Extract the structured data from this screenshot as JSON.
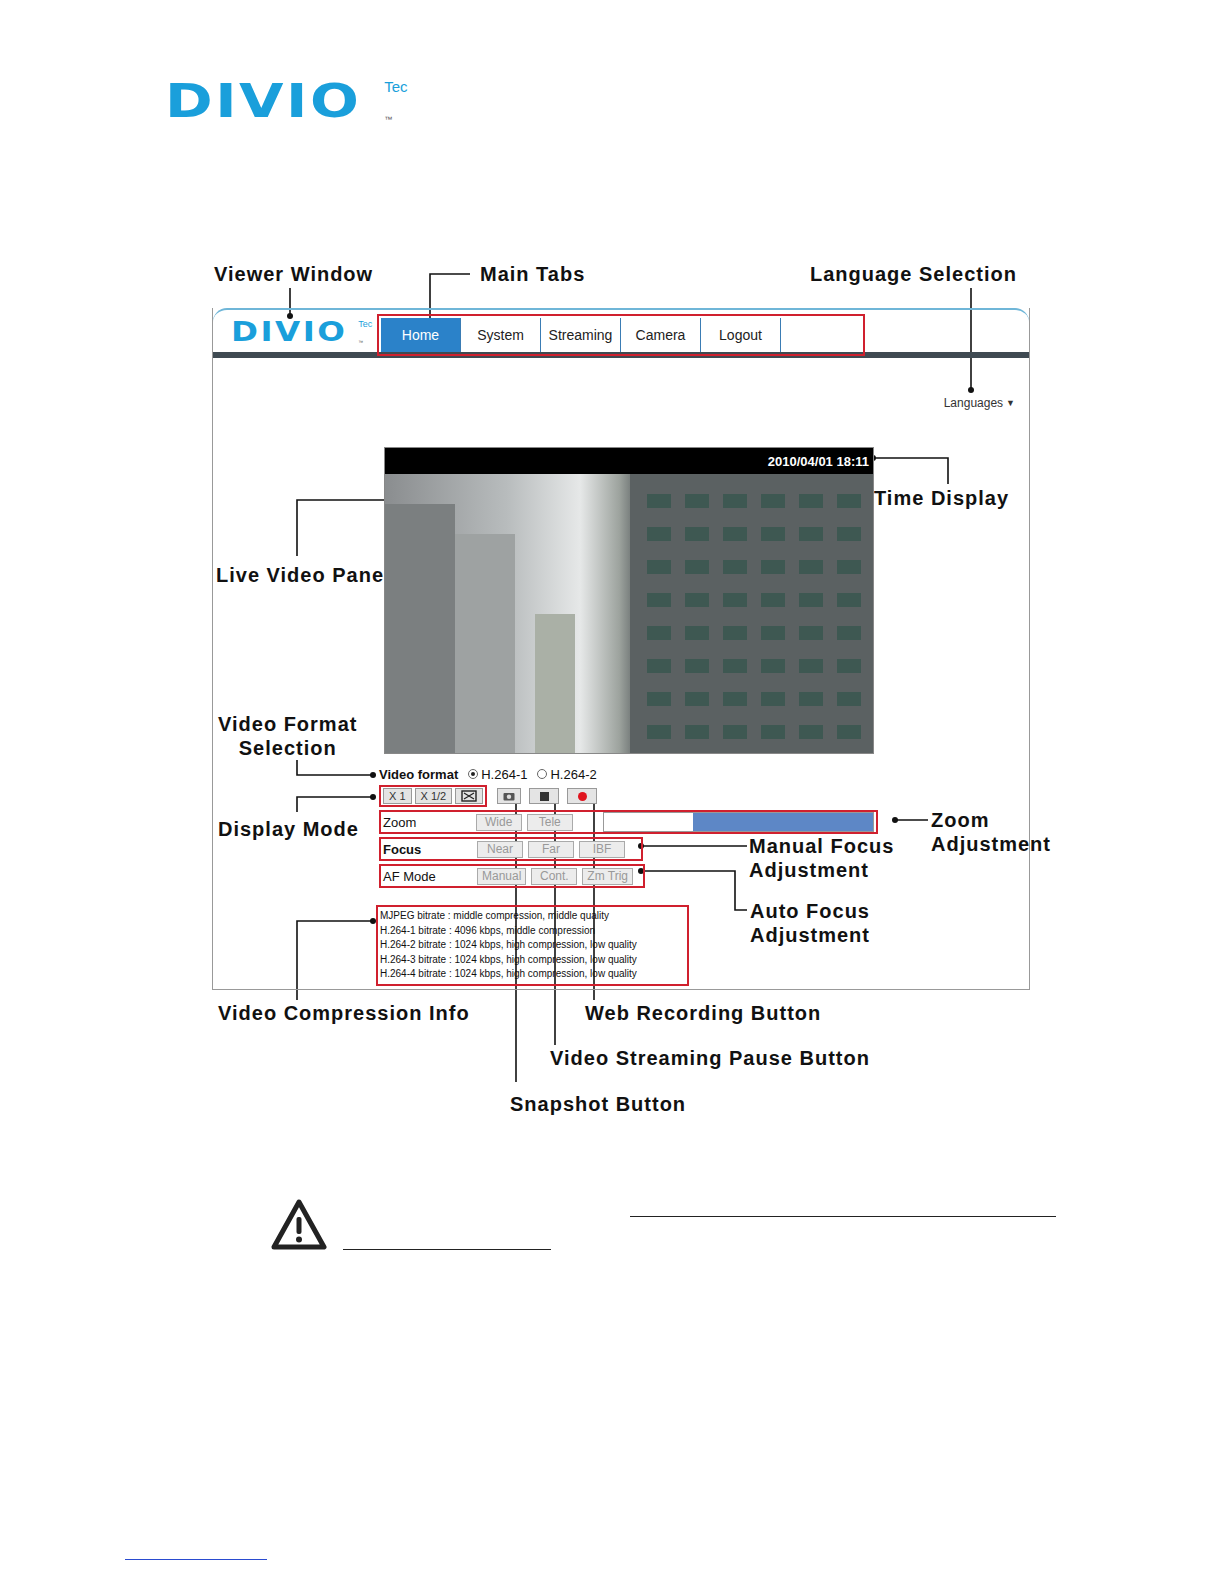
{
  "page_logo": {
    "name": "DIVIO",
    "suffix": "Tec",
    "tm": "™"
  },
  "figure": {
    "callouts": [
      {
        "lines": [
          "Viewer Window"
        ]
      },
      {
        "lines": [
          "Main Tabs"
        ]
      },
      {
        "lines": [
          "Language Selection"
        ]
      },
      {
        "lines": [
          "Time Display"
        ]
      },
      {
        "lines": [
          "Live Video Pane"
        ]
      },
      {
        "lines": [
          "Video Format",
          "Selection"
        ]
      },
      {
        "lines": [
          "Display Mode"
        ]
      },
      {
        "lines": [
          "Zoom",
          "Adjustment"
        ]
      },
      {
        "lines": [
          "Manual Focus",
          "Adjustment"
        ]
      },
      {
        "lines": [
          "Auto Focus",
          "Adjustment"
        ]
      },
      {
        "lines": [
          "Video Compression Info"
        ]
      },
      {
        "lines": [
          "Web Recording Button"
        ]
      },
      {
        "lines": [
          "Video Streaming Pause Button"
        ]
      },
      {
        "lines": [
          "Snapshot Button"
        ]
      }
    ],
    "viewer": {
      "logo": {
        "name": "DIVIO",
        "suffix": "Tec",
        "tm": "™"
      },
      "tabs": [
        {
          "label": "Home",
          "selected": true
        },
        {
          "label": "System",
          "selected": false
        },
        {
          "label": "Streaming",
          "selected": false
        },
        {
          "label": "Camera",
          "selected": false
        },
        {
          "label": "Logout",
          "selected": false
        }
      ],
      "language": {
        "label": "Languages",
        "arrow": "▼"
      },
      "time": "2010/04/01 18:11",
      "video_format": {
        "label": "Video format",
        "options": [
          {
            "label": "H.264-1",
            "selected": true
          },
          {
            "label": "H.264-2",
            "selected": false
          }
        ]
      },
      "display_modes": [
        "X 1",
        "X 1/2"
      ],
      "zoom": {
        "label": "Zoom",
        "buttons": [
          "Wide",
          "Tele"
        ],
        "level": 0.67
      },
      "focus": {
        "label": "Focus",
        "buttons": [
          "Near",
          "Far",
          "IBF"
        ]
      },
      "af_mode": {
        "label": "AF Mode",
        "buttons": [
          "Manual",
          "Cont.",
          "Zm Trig"
        ]
      },
      "compression_info": [
        "MJPEG bitrate : middle compression, middle quality",
        "H.264-1 bitrate : 4096 kbps, middle compression",
        "H.264-2 bitrate : 1024 kbps, high compression, low quality",
        "H.264-3 bitrate : 1024 kbps, high compression, low quality",
        "H.264-4 bitrate : 1024 kbps, high compression, low quality"
      ]
    }
  }
}
